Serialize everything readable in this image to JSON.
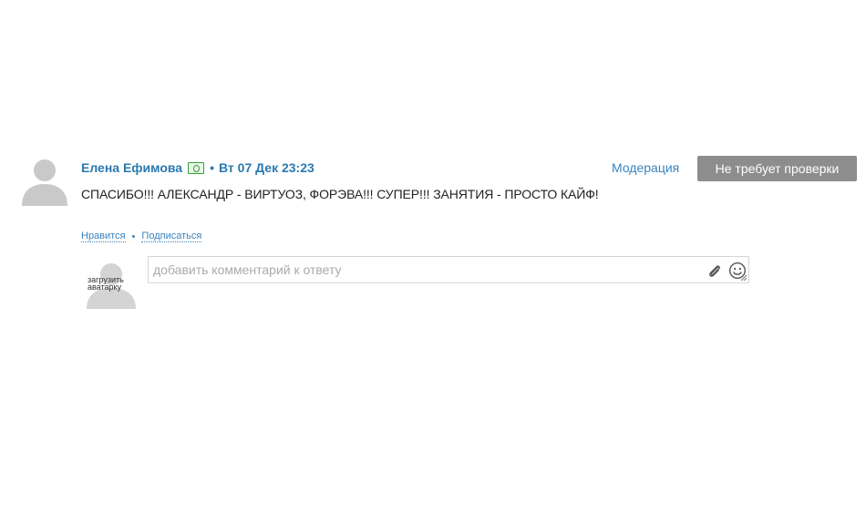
{
  "comment": {
    "author": "Елена Ефимова",
    "separator": "•",
    "timestamp": "Вт 07 Дек 23:23",
    "text": "СПАСИБО!!! АЛЕКСАНДР - ВИРТУОЗ, ФОРЭВА!!! СУПЕР!!! ЗАНЯТИЯ - ПРОСТО КАЙФ!",
    "moderation_label": "Модерация",
    "status_label": "Не требует проверки"
  },
  "actions": {
    "like_label": "Нравится",
    "dot": "•",
    "subscribe_label": "Подписаться"
  },
  "reply": {
    "upload_avatar_label": "загрузить аватарку",
    "placeholder": "добавить комментарий к ответу",
    "value": ""
  },
  "icons": {
    "avatar": "user-silhouette-icon",
    "money": "money-icon",
    "attach": "paperclip-icon",
    "emoji": "smiley-icon",
    "resize": "resize-handle-icon"
  },
  "colors": {
    "link": "#2b79b0",
    "status_bg": "#8d8d8d",
    "avatar": "#c9c9c9"
  }
}
